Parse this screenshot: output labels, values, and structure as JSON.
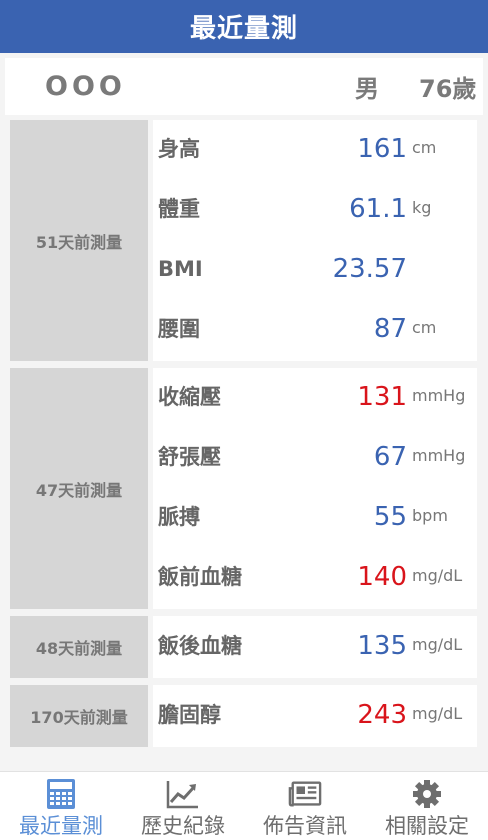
{
  "header": {
    "title": "最近量測"
  },
  "user": {
    "name": "OOO",
    "gender": "男",
    "age": "76歲"
  },
  "groups": [
    {
      "when": "51天前測量",
      "rows": [
        {
          "label": "身高",
          "value": "161",
          "unit": "cm",
          "color": "#3a63b1"
        },
        {
          "label": "體重",
          "value": "61.1",
          "unit": "kg",
          "color": "#3a63b1"
        },
        {
          "label": "BMI",
          "value": "23.57",
          "unit": "",
          "color": "#3a63b1"
        },
        {
          "label": "腰圍",
          "value": "87",
          "unit": "cm",
          "color": "#3a63b1"
        }
      ]
    },
    {
      "when": "47天前測量",
      "rows": [
        {
          "label": "收縮壓",
          "value": "131",
          "unit": "mmHg",
          "color": "#d9141b"
        },
        {
          "label": "舒張壓",
          "value": "67",
          "unit": "mmHg",
          "color": "#3a63b1"
        },
        {
          "label": "脈搏",
          "value": "55",
          "unit": "bpm",
          "color": "#3a63b1"
        },
        {
          "label": "飯前血糖",
          "value": "140",
          "unit": "mg/dL",
          "color": "#d9141b"
        }
      ]
    },
    {
      "when": "48天前測量",
      "rows": [
        {
          "label": "飯後血糖",
          "value": "135",
          "unit": "mg/dL",
          "color": "#3a63b1"
        }
      ]
    },
    {
      "when": "170天前測量",
      "rows": [
        {
          "label": "膽固醇",
          "value": "243",
          "unit": "mg/dL",
          "color": "#d9141b"
        }
      ]
    }
  ],
  "tabs": [
    {
      "label": "最近量測",
      "icon": "calculator-icon",
      "active": true
    },
    {
      "label": "歷史紀錄",
      "icon": "trend-chart-icon",
      "active": false
    },
    {
      "label": "佈告資訊",
      "icon": "newspaper-icon",
      "active": false
    },
    {
      "label": "相關設定",
      "icon": "gear-icon",
      "active": false
    }
  ],
  "colors": {
    "header": "#3a63b1",
    "active_tab": "#5b8fd6",
    "high": "#d9141b",
    "normal": "#3a63b1"
  }
}
